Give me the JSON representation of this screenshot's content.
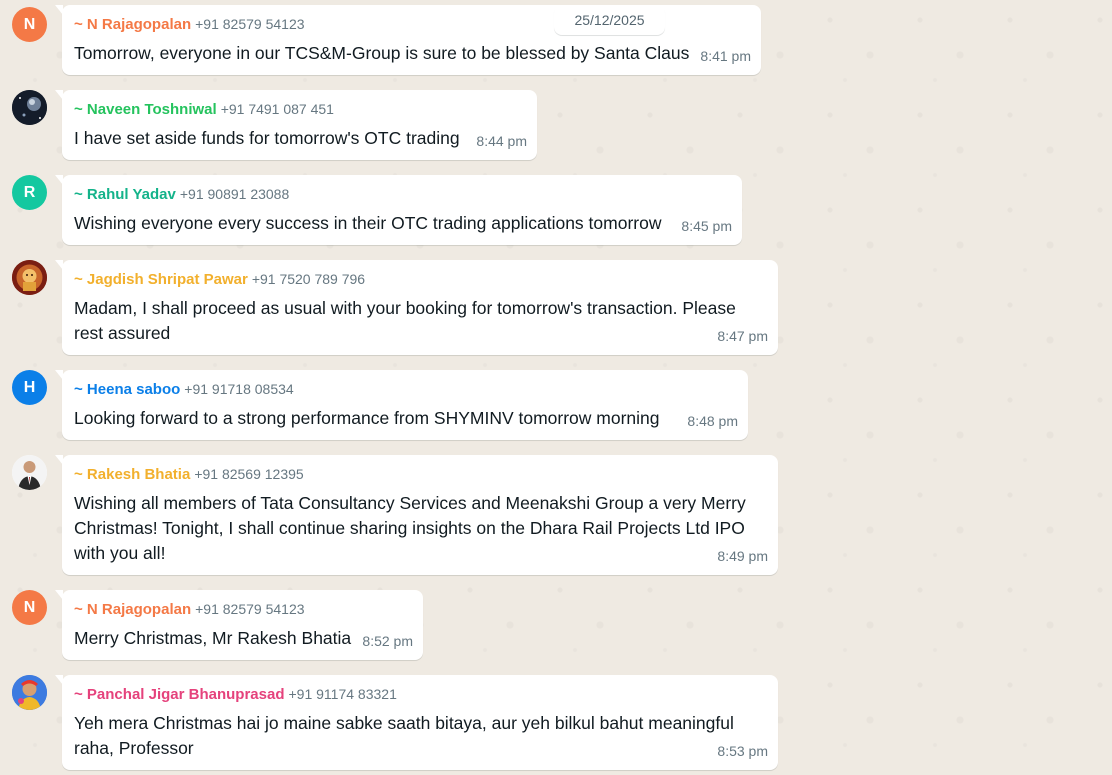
{
  "date_divider": "25/12/2025",
  "colors": {
    "chat_background": "#efeae2",
    "bubble": "#ffffff",
    "timestamp": "#667781"
  },
  "messages": [
    {
      "avatar": {
        "type": "initial",
        "initial": "N",
        "color": "#f47946"
      },
      "sender": "~ N Rajagopalan",
      "sender_color": "#f47946",
      "phone": "+91 82579 54123",
      "text": "Tomorrow, everyone in our TCS&M-Group is sure to be blessed by Santa Claus",
      "time": "8:41 pm"
    },
    {
      "avatar": {
        "type": "image",
        "icon": "space-photo-icon"
      },
      "sender": "~ Naveen Toshniwal",
      "sender_color": "#25c35e",
      "phone": "+91 7491 087 451",
      "text": "I have set aside funds for tomorrow's OTC trading",
      "time": "8:44 pm"
    },
    {
      "avatar": {
        "type": "initial",
        "initial": "R",
        "color": "#14c8a0"
      },
      "sender": "~ Rahul Yadav",
      "sender_color": "#14b38a",
      "phone": "+91 90891 23088",
      "text": "Wishing everyone every success in their OTC trading applications tomorrow",
      "time": "8:45 pm"
    },
    {
      "avatar": {
        "type": "image",
        "icon": "deity-photo-icon"
      },
      "sender": "~ Jagdish Shripat Pawar",
      "sender_color": "#f2b02d",
      "phone": "+91 7520 789 796",
      "text": "Madam, I shall proceed as usual with your booking for tomorrow's transaction. Please\nrest assured",
      "time": "8:47 pm"
    },
    {
      "avatar": {
        "type": "initial",
        "initial": "H",
        "color": "#0b7fe8"
      },
      "sender": "~ Heena saboo",
      "sender_color": "#0b7fe8",
      "phone": "+91 91718 08534",
      "text": "Looking forward to a strong performance from SHYMINV tomorrow morning",
      "time": "8:48 pm"
    },
    {
      "avatar": {
        "type": "image",
        "icon": "man-in-suit-photo-icon"
      },
      "sender": "~ Rakesh Bhatia",
      "sender_color": "#f2b02d",
      "phone": "+91 82569 12395",
      "text": "Wishing all members of Tata Consultancy Services and Meenakshi Group a very Merry\nChristmas! Tonight, I shall continue sharing insights on the Dhara Rail Projects Ltd IPO\nwith you all!",
      "time": "8:49 pm"
    },
    {
      "avatar": {
        "type": "initial",
        "initial": "N",
        "color": "#f47946"
      },
      "sender": "~ N Rajagopalan",
      "sender_color": "#f47946",
      "phone": "+91 82579 54123",
      "text": "Merry Christmas, Mr Rakesh Bhatia",
      "time": "8:52 pm"
    },
    {
      "avatar": {
        "type": "image",
        "icon": "colorful-portrait-photo-icon"
      },
      "sender": "~ Panchal Jigar Bhanuprasad",
      "sender_color": "#e5427c",
      "phone": "+91 91174 83321",
      "text": "Yeh mera Christmas hai jo maine sabke saath bitaya, aur yeh bilkul bahut meaningful\nraha, Professor",
      "time": "8:53 pm"
    }
  ]
}
